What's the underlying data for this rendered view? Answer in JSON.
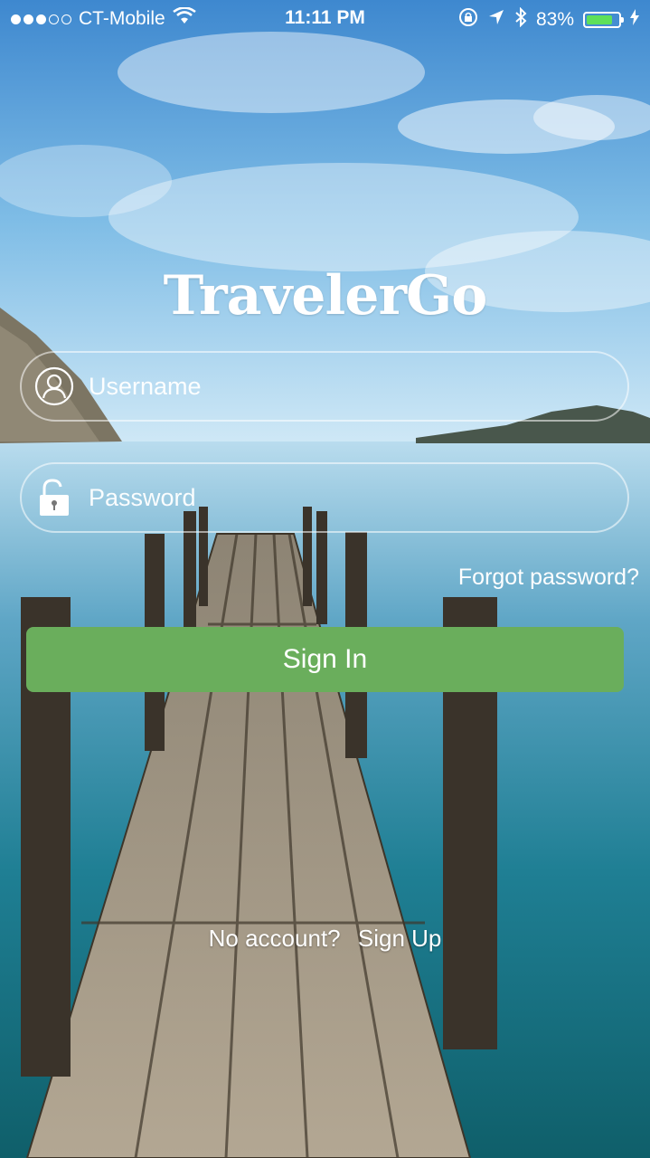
{
  "status_bar": {
    "carrier": "CT-Mobile",
    "signal_strength": 3,
    "signal_max": 5,
    "time": "11:11 PM",
    "battery_percent": "83%",
    "battery_level": 0.83,
    "icons": [
      "wifi-icon",
      "orientation-lock-icon",
      "location-icon",
      "bluetooth-icon",
      "battery-icon",
      "charging-icon"
    ]
  },
  "app": {
    "title": "TravelerGo"
  },
  "login": {
    "username_placeholder": "Username",
    "password_placeholder": "Password",
    "forgot_password": "Forgot password?",
    "sign_in": "Sign In",
    "no_account": "No account?",
    "sign_up": "Sign Up"
  },
  "colors": {
    "accent": "#6aae5c",
    "battery_fill": "#5ee05a"
  }
}
